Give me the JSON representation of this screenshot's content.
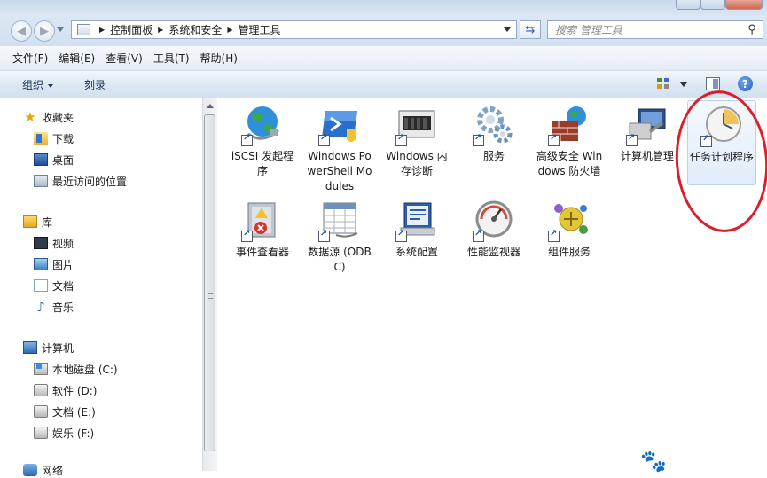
{
  "address_bar": {
    "breadcrumbs": [
      "控制面板",
      "系统和安全",
      "管理工具"
    ]
  },
  "search": {
    "placeholder": "搜索 管理工具"
  },
  "menu": [
    "文件(F)",
    "编辑(E)",
    "查看(V)",
    "工具(T)",
    "帮助(H)"
  ],
  "commands": {
    "organize": "组织",
    "burn": "刻录"
  },
  "nav": {
    "favorites": {
      "label": "收藏夹",
      "items": [
        "下载",
        "桌面",
        "最近访问的位置"
      ]
    },
    "libraries": {
      "label": "库",
      "items": [
        "视频",
        "图片",
        "文档",
        "音乐"
      ]
    },
    "computer": {
      "label": "计算机",
      "items": [
        "本地磁盘 (C:)",
        "软件 (D:)",
        "文档 (E:)",
        "娱乐 (F:)"
      ]
    },
    "network": {
      "label": "网络"
    }
  },
  "items": [
    {
      "label": "iSCSI 发起程序",
      "icon": "globe-icon"
    },
    {
      "label": "Windows PowerShell Modules",
      "icon": "powershell-icon"
    },
    {
      "label": "Windows 内存诊断",
      "icon": "memory-chip-icon"
    },
    {
      "label": "服务",
      "icon": "gears-icon"
    },
    {
      "label": "高级安全 Windows 防火墙",
      "icon": "firewall-icon"
    },
    {
      "label": "计算机管理",
      "icon": "computer-management-icon"
    },
    {
      "label": "任务计划程序",
      "icon": "clock-icon",
      "selected": true
    },
    {
      "label": "事件查看器",
      "icon": "event-viewer-icon"
    },
    {
      "label": "数据源 (ODBC)",
      "icon": "odbc-icon"
    },
    {
      "label": "系统配置",
      "icon": "system-config-icon"
    },
    {
      "label": "性能监视器",
      "icon": "gauge-icon"
    },
    {
      "label": "组件服务",
      "icon": "component-services-icon"
    }
  ],
  "colors": {
    "highlight_ring": "#d9202a",
    "toolbar": "#dbe6f3"
  }
}
